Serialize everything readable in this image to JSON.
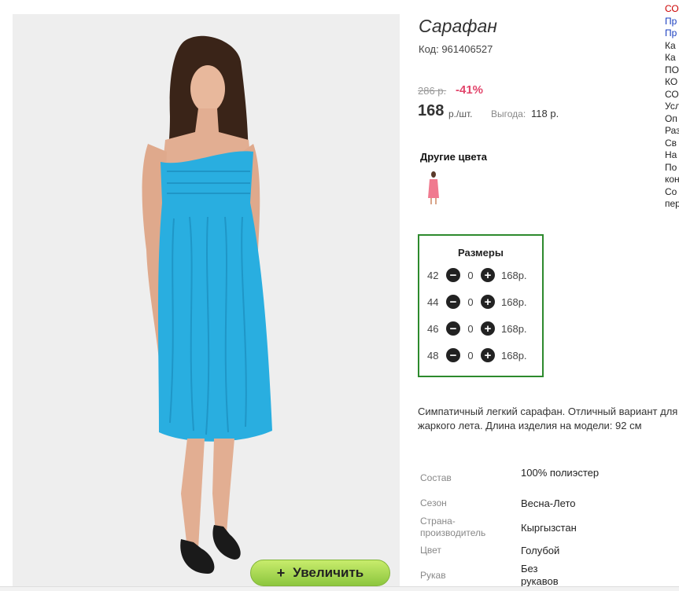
{
  "product": {
    "title": "Сарафан",
    "code": "Код: 961406527",
    "old_price": "286 р.",
    "discount": "-41%",
    "price": "168",
    "price_unit": "р./шт.",
    "savings_label": "Выгода:",
    "savings_value": "118 р.",
    "zoom_label": "Увеличить"
  },
  "other_colors": {
    "heading": "Другие цвета",
    "thumb_color": "#f07a8f"
  },
  "sizes": {
    "heading": "Размеры",
    "rows": [
      {
        "size": "42",
        "qty": "0",
        "price": "168р."
      },
      {
        "size": "44",
        "qty": "0",
        "price": "168р."
      },
      {
        "size": "46",
        "qty": "0",
        "price": "168р."
      },
      {
        "size": "48",
        "qty": "0",
        "price": "168р."
      }
    ]
  },
  "description": "Симпатичный легкий сарафан. Отличный вариант для жаркого лета. Длина изделия на модели: 92 см",
  "specs": [
    {
      "label": "Состав",
      "value": "100% полиэстер"
    },
    {
      "label": "Сезон",
      "value": "Весна-Лето"
    },
    {
      "label": "Страна-производитель",
      "value": "Кыргызстан"
    },
    {
      "label": "Цвет",
      "value": "Голубой"
    },
    {
      "label": "Рукав",
      "value": "Без рукавов"
    }
  ],
  "side_links": [
    {
      "text": "СО",
      "kind": "red"
    },
    {
      "text": "Пр",
      "kind": "blue"
    },
    {
      "text": "Пр",
      "kind": "blue"
    },
    {
      "text": "Ка",
      "kind": "black"
    },
    {
      "text": "Ка",
      "kind": "black"
    },
    {
      "text": "ПО",
      "kind": "black"
    },
    {
      "text": "КО",
      "kind": "black"
    },
    {
      "text": "СО",
      "kind": "black"
    },
    {
      "text": "Усл",
      "kind": "black"
    },
    {
      "text": "Оп",
      "kind": "black"
    },
    {
      "text": "Раз",
      "kind": "black"
    },
    {
      "text": "Св",
      "kind": "black"
    },
    {
      "text": "На",
      "kind": "black"
    },
    {
      "text": "По",
      "kind": "black"
    },
    {
      "text": "кон",
      "kind": "black"
    },
    {
      "text": "Со",
      "kind": "black"
    },
    {
      "text": "пер",
      "kind": "black"
    }
  ],
  "colors": {
    "dress": "#29aee0",
    "frame": "#2d8a2d",
    "discount": "#e2456b",
    "button": "#a8d854"
  }
}
